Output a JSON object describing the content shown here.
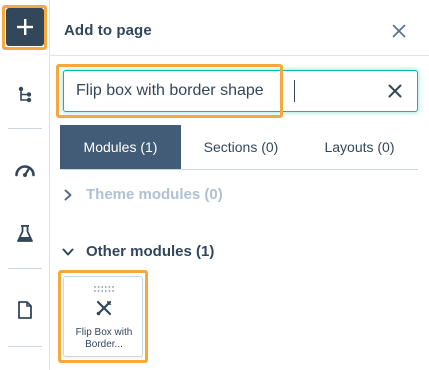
{
  "rail": {
    "icons": [
      "plus-icon",
      "tree-icon",
      "gauge-icon",
      "flask-icon",
      "page-icon"
    ]
  },
  "panel": {
    "title": "Add to page",
    "search": {
      "value": "Flip box with border shape",
      "placeholder": ""
    },
    "tabs": [
      {
        "label": "Modules (1)",
        "active": true
      },
      {
        "label": "Sections (0)",
        "active": false
      },
      {
        "label": "Layouts (0)",
        "active": false
      }
    ],
    "sections": [
      {
        "label": "Theme modules (0)",
        "expanded": false
      },
      {
        "label": "Other modules (1)",
        "expanded": true
      }
    ],
    "modules": [
      {
        "label": "Flip Box with Border...",
        "icon": "tools-icon"
      }
    ]
  },
  "colors": {
    "accent": "#f5a93b",
    "focus": "#00bda5",
    "dark": "#33475b",
    "active_tab": "#425b76"
  }
}
